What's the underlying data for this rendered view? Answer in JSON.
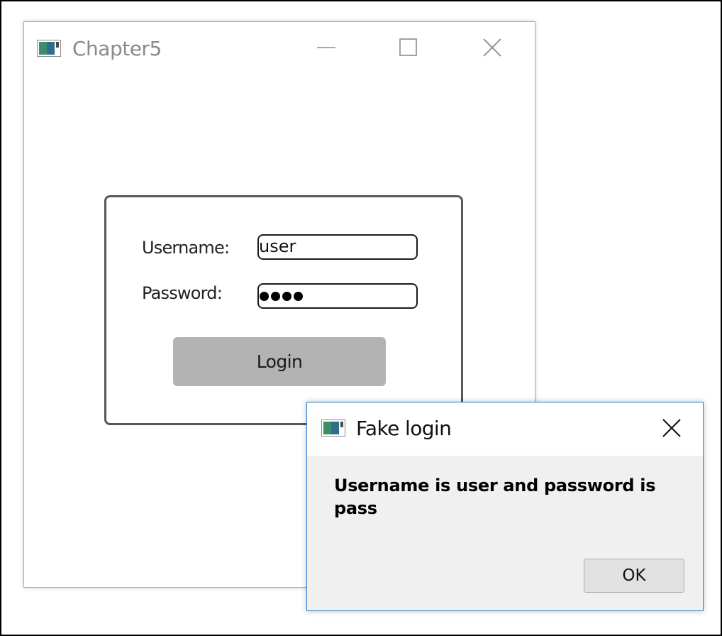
{
  "main_window": {
    "title": "Chapter5",
    "icon": "app-window-icon",
    "controls": {
      "minimize_icon": "minimize-icon",
      "maximize_icon": "maximize-icon",
      "close_icon": "close-icon"
    },
    "login_form": {
      "username_label": "Username:",
      "username_value": "user",
      "password_label": "Password:",
      "password_masked_length": 4,
      "login_button_label": "Login"
    }
  },
  "dialog": {
    "title": "Fake login",
    "icon": "app-window-icon",
    "close_icon": "close-icon",
    "message": "Username is user and password is pass",
    "ok_label": "OK"
  },
  "colors": {
    "dialog_border": "#2b7fd1",
    "login_button_bg": "#b3b3b3",
    "dialog_body_bg": "#f0f0f0"
  }
}
